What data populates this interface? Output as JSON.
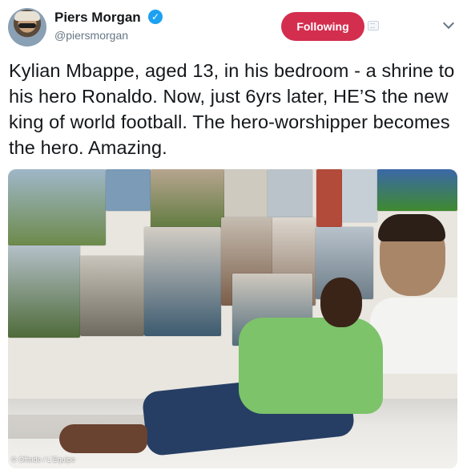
{
  "author": {
    "name": "Piers Morgan",
    "handle": "@piersmorgan",
    "verified_icon": "verified-badge-icon"
  },
  "actions": {
    "follow_label": "Following",
    "notification_icon": "notification-icon",
    "menu_icon": "chevron-down-icon"
  },
  "tweet": {
    "text": "Kylian Mbappe, aged 13, in his bedroom - a shrine to his hero Ronaldo. Now, just 6yrs later, HE’S the new king of world football. The hero-worshipper becomes the hero. Amazing."
  },
  "photo": {
    "credit": "© Offside / L'Equipe"
  },
  "colors": {
    "follow_button": "#d42e4f",
    "verified": "#1da1f2",
    "handle": "#657786"
  }
}
